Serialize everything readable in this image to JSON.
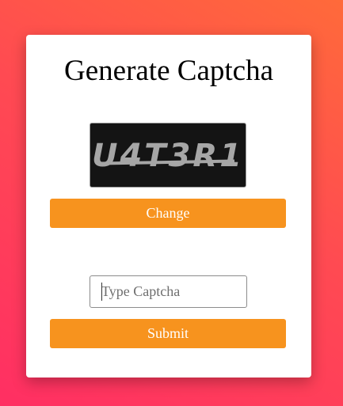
{
  "page": {
    "title": "Generate Captcha"
  },
  "captcha": {
    "code": "U4T3R1",
    "change_label": "Change"
  },
  "form": {
    "input_value": "",
    "input_placeholder": "Type Captcha",
    "submit_label": "Submit"
  },
  "colors": {
    "accent": "#f7931e",
    "captcha_bg": "#141414",
    "captcha_text": "#a6a6a6"
  }
}
